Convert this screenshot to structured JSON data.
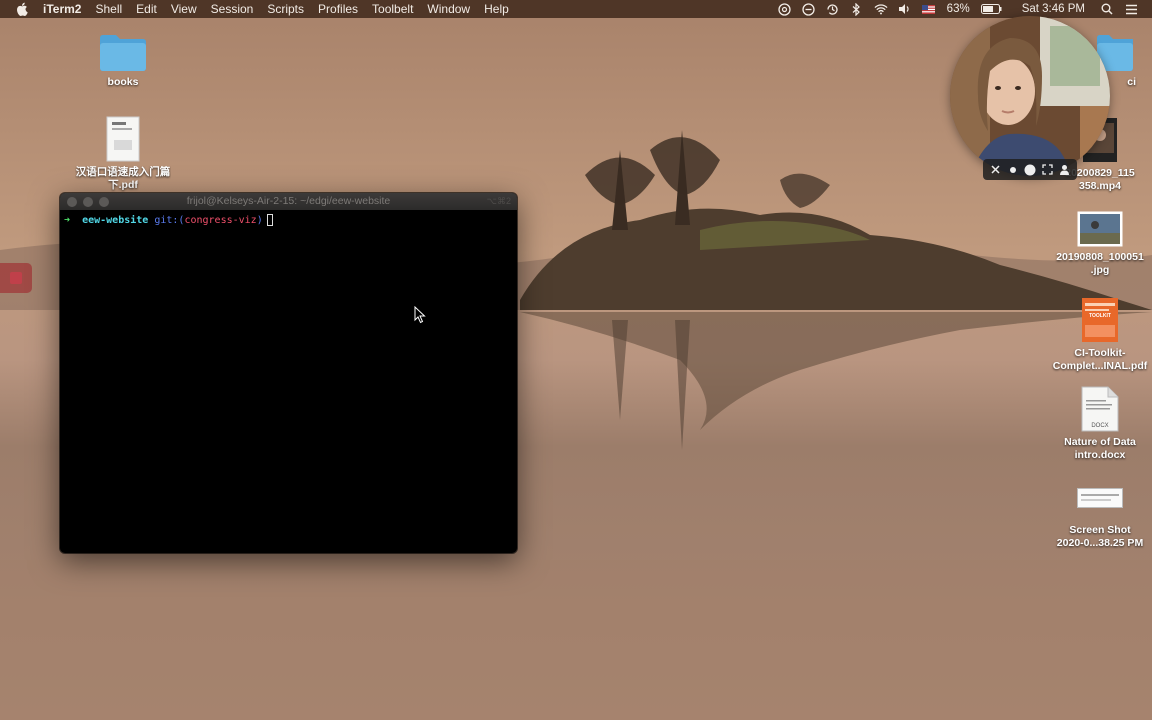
{
  "menubar": {
    "app_name": "iTerm2",
    "items": [
      "Shell",
      "Edit",
      "View",
      "Session",
      "Scripts",
      "Profiles",
      "Toolbelt",
      "Window",
      "Help"
    ],
    "battery": "63%",
    "clock": "Sat 3:46 PM",
    "status_icons": [
      "creative-cloud-icon",
      "sync-icon",
      "time-machine-icon",
      "bluetooth-icon",
      "wifi-icon",
      "volume-icon",
      "us-flag-icon",
      "battery-icon",
      "search-icon",
      "control-center-icon"
    ]
  },
  "desktop_icons": {
    "books": "books",
    "chinese_pdf": "汉语口语速成入门篇\n下.pdf",
    "mp4": "20200829_115\n358.mp4",
    "jpg": "20190808_100051\n.jpg",
    "ci_pdf": "CI-Toolkit-\nComplet...INAL.pdf",
    "docx": "Nature of Data\nintro.docx",
    "docx_badge": "DOCX",
    "screenshot": "Screen Shot\n2020-0...38.25 PM",
    "partial_folder": "ci",
    "toolkit_cover_text": "TOOLKIT"
  },
  "terminal": {
    "title": "frijol@Kelseys-Air-2-15: ~/edgi/eew-website",
    "shortcut": "⌥⌘2",
    "prompt_arrow": "➜",
    "prompt_dir": "eew-website",
    "prompt_git": "git:(",
    "prompt_branch": "congress-viz",
    "prompt_git_close": ")"
  },
  "colors": {
    "menubar_bg": "#483022",
    "prompt_arrow": "#4fe16a",
    "prompt_dir": "#51d7e6",
    "prompt_git": "#5b7cf0",
    "prompt_branch": "#f0506b"
  }
}
